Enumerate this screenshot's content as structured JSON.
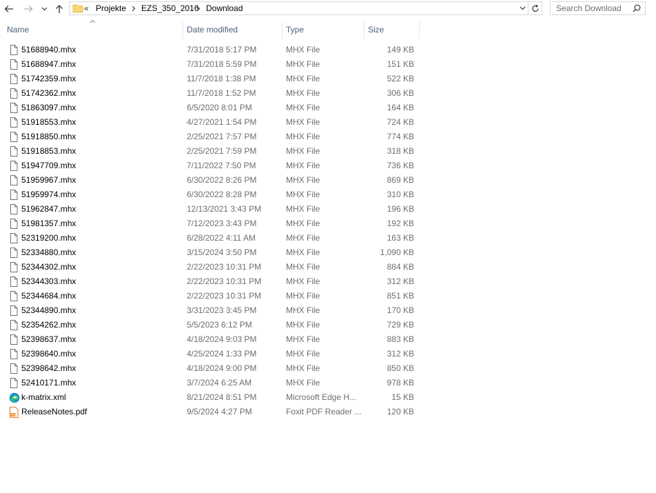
{
  "address": {
    "overflow": "«",
    "crumbs": [
      "Projekte",
      "EZS_350_2016",
      "Download"
    ]
  },
  "search": {
    "placeholder": "Search Download"
  },
  "columns": {
    "name": "Name",
    "date": "Date modified",
    "type": "Type",
    "size": "Size"
  },
  "files": [
    {
      "name": "51688940.mhx",
      "date": "7/31/2018 5:17 PM",
      "type": "MHX File",
      "size": "149 KB",
      "icon": "generic-file-icon"
    },
    {
      "name": "51688947.mhx",
      "date": "7/31/2018 5:59 PM",
      "type": "MHX File",
      "size": "151 KB",
      "icon": "generic-file-icon"
    },
    {
      "name": "51742359.mhx",
      "date": "11/7/2018 1:38 PM",
      "type": "MHX File",
      "size": "522 KB",
      "icon": "generic-file-icon"
    },
    {
      "name": "51742362.mhx",
      "date": "11/7/2018 1:52 PM",
      "type": "MHX File",
      "size": "306 KB",
      "icon": "generic-file-icon"
    },
    {
      "name": "51863097.mhx",
      "date": "6/5/2020 8:01 PM",
      "type": "MHX File",
      "size": "164 KB",
      "icon": "generic-file-icon"
    },
    {
      "name": "51918553.mhx",
      "date": "4/27/2021 1:54 PM",
      "type": "MHX File",
      "size": "724 KB",
      "icon": "generic-file-icon"
    },
    {
      "name": "51918850.mhx",
      "date": "2/25/2021 7:57 PM",
      "type": "MHX File",
      "size": "774 KB",
      "icon": "generic-file-icon"
    },
    {
      "name": "51918853.mhx",
      "date": "2/25/2021 7:59 PM",
      "type": "MHX File",
      "size": "318 KB",
      "icon": "generic-file-icon"
    },
    {
      "name": "51947709.mhx",
      "date": "7/11/2022 7:50 PM",
      "type": "MHX File",
      "size": "736 KB",
      "icon": "generic-file-icon"
    },
    {
      "name": "51959967.mhx",
      "date": "6/30/2022 8:26 PM",
      "type": "MHX File",
      "size": "869 KB",
      "icon": "generic-file-icon"
    },
    {
      "name": "51959974.mhx",
      "date": "6/30/2022 8:28 PM",
      "type": "MHX File",
      "size": "310 KB",
      "icon": "generic-file-icon"
    },
    {
      "name": "51962847.mhx",
      "date": "12/13/2021 3:43 PM",
      "type": "MHX File",
      "size": "196 KB",
      "icon": "generic-file-icon"
    },
    {
      "name": "51981357.mhx",
      "date": "7/12/2023 3:43 PM",
      "type": "MHX File",
      "size": "192 KB",
      "icon": "generic-file-icon"
    },
    {
      "name": "52319200.mhx",
      "date": "6/28/2022 4:11 AM",
      "type": "MHX File",
      "size": "163 KB",
      "icon": "generic-file-icon"
    },
    {
      "name": "52334880.mhx",
      "date": "3/15/2024 3:50 PM",
      "type": "MHX File",
      "size": "1,090 KB",
      "icon": "generic-file-icon"
    },
    {
      "name": "52344302.mhx",
      "date": "2/22/2023 10:31 PM",
      "type": "MHX File",
      "size": "884 KB",
      "icon": "generic-file-icon"
    },
    {
      "name": "52344303.mhx",
      "date": "2/22/2023 10:31 PM",
      "type": "MHX File",
      "size": "312 KB",
      "icon": "generic-file-icon"
    },
    {
      "name": "52344684.mhx",
      "date": "2/22/2023 10:31 PM",
      "type": "MHX File",
      "size": "851 KB",
      "icon": "generic-file-icon"
    },
    {
      "name": "52344890.mhx",
      "date": "3/31/2023 3:45 PM",
      "type": "MHX File",
      "size": "170 KB",
      "icon": "generic-file-icon"
    },
    {
      "name": "52354262.mhx",
      "date": "5/5/2023 6:12 PM",
      "type": "MHX File",
      "size": "729 KB",
      "icon": "generic-file-icon"
    },
    {
      "name": "52398637.mhx",
      "date": "4/18/2024 9:03 PM",
      "type": "MHX File",
      "size": "883 KB",
      "icon": "generic-file-icon"
    },
    {
      "name": "52398640.mhx",
      "date": "4/25/2024 1:33 PM",
      "type": "MHX File",
      "size": "312 KB",
      "icon": "generic-file-icon"
    },
    {
      "name": "52398642.mhx",
      "date": "4/18/2024 9:00 PM",
      "type": "MHX File",
      "size": "850 KB",
      "icon": "generic-file-icon"
    },
    {
      "name": "52410171.mhx",
      "date": "3/7/2024 6:25 AM",
      "type": "MHX File",
      "size": "978 KB",
      "icon": "generic-file-icon"
    },
    {
      "name": "k-matrix.xml",
      "date": "8/21/2024 8:51 PM",
      "type": "Microsoft Edge H...",
      "size": "15 KB",
      "icon": "edge-icon"
    },
    {
      "name": "ReleaseNotes.pdf",
      "date": "9/5/2024 4:27 PM",
      "type": "Foxit PDF Reader ...",
      "size": "120 KB",
      "icon": "pdf-icon"
    }
  ],
  "colors": {
    "header_text": "#4c607a",
    "secondary_text": "#6d6d6d",
    "folder": "#f8d775"
  }
}
